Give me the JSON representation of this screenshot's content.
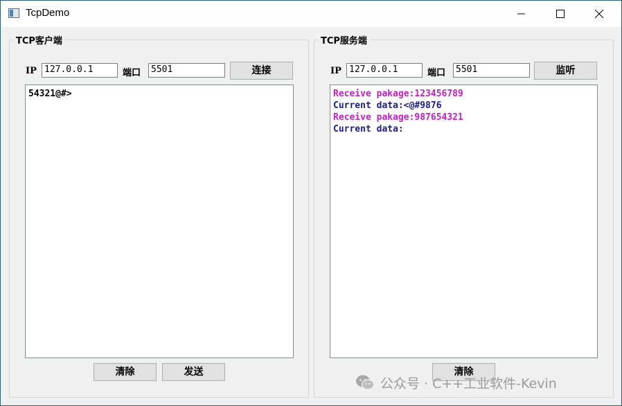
{
  "window": {
    "title": "TcpDemo"
  },
  "client": {
    "group_label": "TCP客户端",
    "ip_label": "IP",
    "ip_value": "127.0.0.1",
    "port_label": "端口",
    "port_value": "5501",
    "connect_label": "连接",
    "log_text": "54321@#>",
    "clear_label": "清除",
    "send_label": "发送"
  },
  "server": {
    "group_label": "TCP服务端",
    "ip_label": "IP",
    "ip_value": "127.0.0.1",
    "port_label": "端口",
    "port_value": "5501",
    "listen_label": "监听",
    "log_lines": [
      {
        "text": "Receive pakage:123456789",
        "color": "#c020c0"
      },
      {
        "text": "Current data:<@#9876",
        "color": "#1a1a8c"
      },
      {
        "text": "Receive pakage:987654321",
        "color": "#c020c0"
      },
      {
        "text": "Current data:",
        "color": "#1a1a8c"
      }
    ],
    "clear_label": "清除"
  },
  "watermark": {
    "text": "公众号 · C++工业软件-Kevin"
  },
  "icons": [
    "app-icon",
    "minimize-icon",
    "maximize-icon",
    "close-icon",
    "wechat-icon"
  ]
}
